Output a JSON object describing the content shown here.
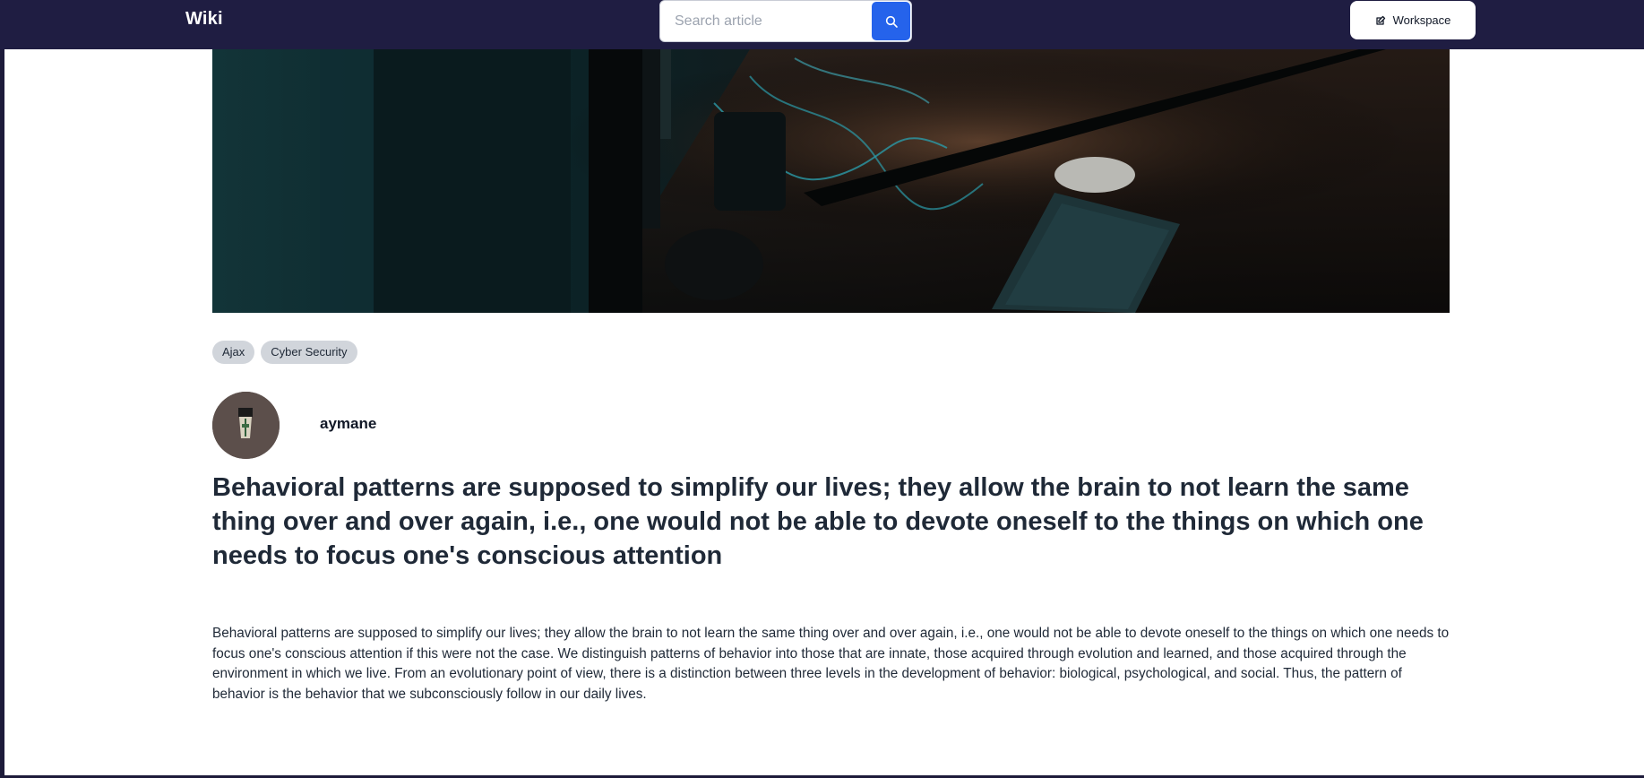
{
  "nav": {
    "brand": "Wiki",
    "search_placeholder": "Search article",
    "workspace_label": "Workspace",
    "search_icon": "search-icon",
    "workspace_icon": "edit-icon"
  },
  "article": {
    "tags": [
      "Ajax",
      "Cyber Security"
    ],
    "author": "aymane",
    "title": "Behavioral patterns are supposed to simplify our lives; they allow the brain to not learn the same thing over and over again, i.e., one would not be able to devote oneself to the things on which one needs to focus one's conscious attention",
    "body": "Behavioral patterns are supposed to simplify our lives; they allow the brain to not learn the same thing over and over again, i.e., one would not be able to devote oneself to the things on which one needs to focus one's conscious attention if this were not the case. We distinguish patterns of behavior into those that are innate, those acquired through evolution and learned, and those acquired through the environment in which we live. From an evolutionary point of view, there is a distinction between three levels in the development of behavior: biological, psychological, and social. Thus, the pattern of behavior is the behavior that we subconsciously follow in our daily lives."
  },
  "colors": {
    "navbar": "#1f1d42",
    "search_button": "#2563eb",
    "tag_bg": "#d1d5db",
    "text": "#1f2937"
  }
}
